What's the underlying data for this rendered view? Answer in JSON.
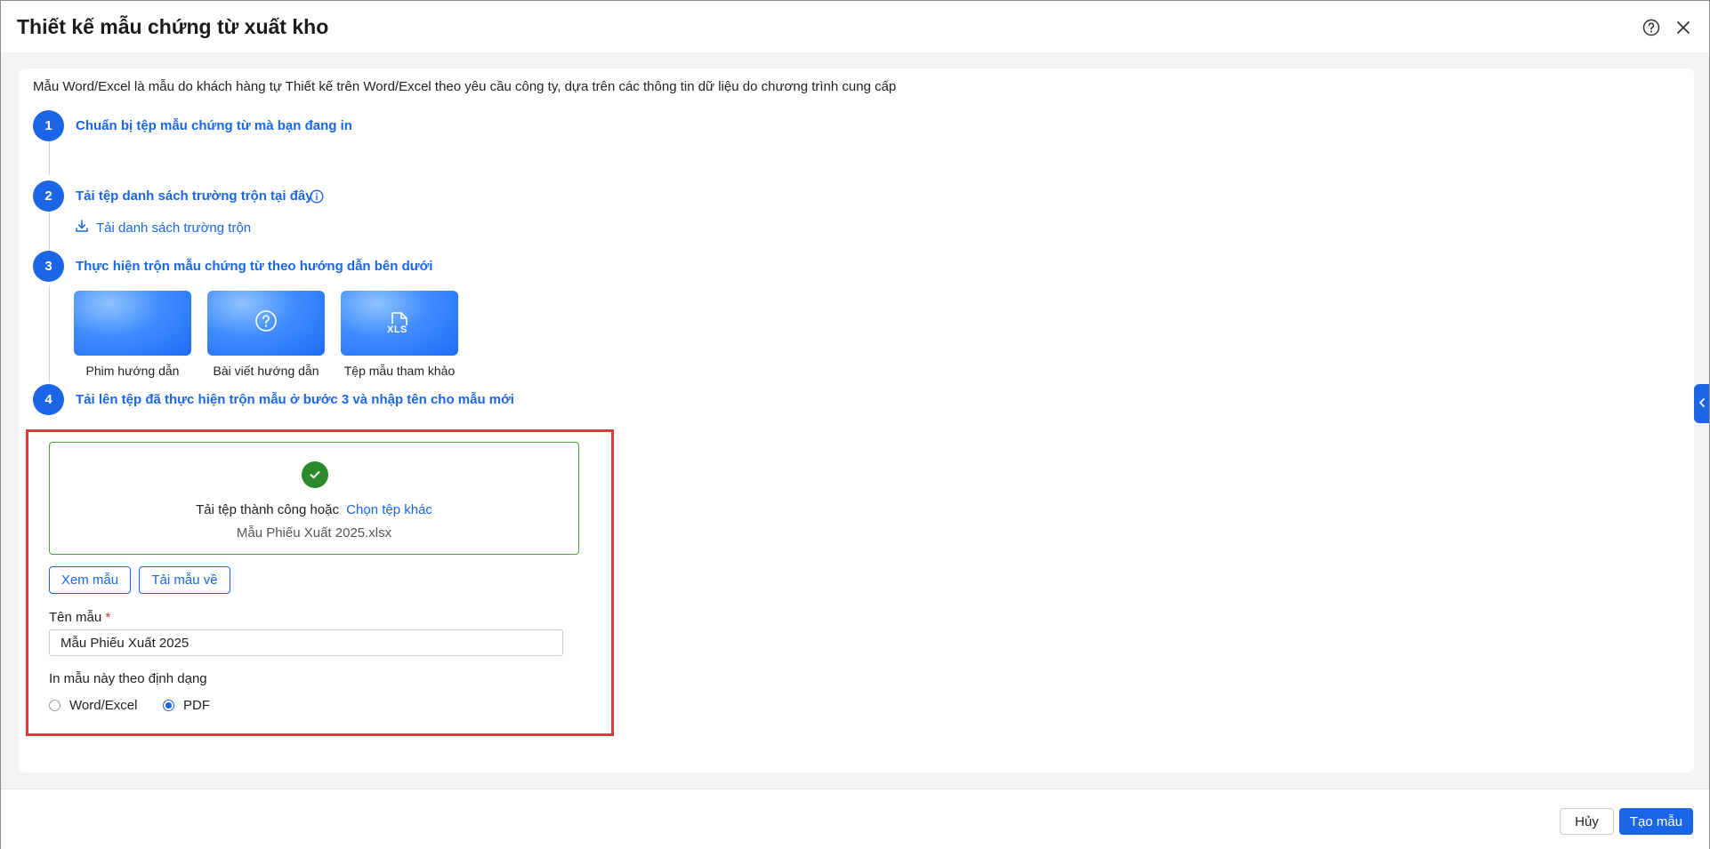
{
  "window": {
    "title": "Thiết kế mẫu chứng từ xuất kho"
  },
  "header_icons": [
    "help-icon",
    "close-icon"
  ],
  "description": "Mẫu Word/Excel là mẫu do khách hàng tự Thiết kế trên Word/Excel theo yêu cầu công ty, dựa trên các thông tin dữ liệu do chương trình cung cấp",
  "steps": [
    {
      "number": "1",
      "title": "Chuẩn bị tệp mẫu chứng từ mà bạn đang in"
    },
    {
      "number": "2",
      "title": "Tải tệp danh sách trường trộn tại đây",
      "link": "Tải danh sách trường trộn"
    },
    {
      "number": "3",
      "title": "Thực hiện trộn mẫu chứng từ theo hướng dẫn bên dưới"
    },
    {
      "number": "4",
      "title": "Tải lên tệp đã thực hiện trộn mẫu ở bước 3 và nhập tên cho mẫu mới"
    }
  ],
  "guide_cards": [
    {
      "label": "Phim hướng dẫn",
      "icon": ""
    },
    {
      "label": "Bài viết hướng dẫn",
      "icon": "question-circle-icon"
    },
    {
      "label": "Tệp mẫu tham khảo",
      "icon": "xls-file-icon",
      "icon_text": "XLS"
    }
  ],
  "upload": {
    "status": "Tải tệp thành công hoặc",
    "choose_other": "Chọn tệp khác",
    "file_name": "Mẫu Phiếu Xuất 2025.xlsx"
  },
  "actions": {
    "preview": "Xem mẫu",
    "download": "Tải mẫu về"
  },
  "form": {
    "name_label": "Tên mẫu",
    "required_mark": "*",
    "name_value": "Mẫu Phiếu Xuất 2025",
    "format_label": "In mẫu này theo định dạng",
    "format_options": [
      {
        "label": "Word/Excel",
        "checked": false
      },
      {
        "label": "PDF",
        "checked": true
      }
    ]
  },
  "footer": {
    "cancel": "Hủy",
    "create": "Tạo mẫu"
  },
  "colors": {
    "accent": "#1a66e6",
    "success": "#2c8a2c",
    "highlight": "#e8333a"
  }
}
